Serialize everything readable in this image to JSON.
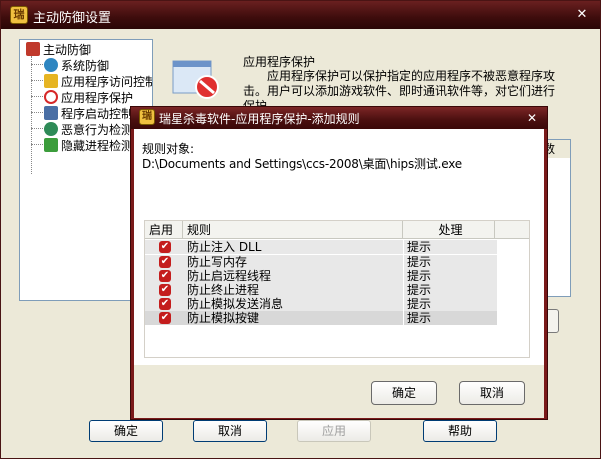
{
  "main_window": {
    "title": "主动防御设置",
    "close_glyph": "✕",
    "icon_glyph": "瑞"
  },
  "tree": {
    "items": [
      {
        "label": "主动防御",
        "icon": "shield-icon",
        "color": "#c0392b"
      },
      {
        "label": "系统防御",
        "icon": "globe-shield-icon",
        "color": "#2e86c1"
      },
      {
        "label": "应用程序访问控制",
        "icon": "folder-key-icon",
        "color": "#e6b422"
      },
      {
        "label": "应用程序保护",
        "icon": "no-entry-icon",
        "color": "#d62828"
      },
      {
        "label": "程序启动控制",
        "icon": "window-icon",
        "color": "#4a6fa5"
      },
      {
        "label": "恶意行为检测",
        "icon": "globe-scan-icon",
        "color": "#2e8b57"
      },
      {
        "label": "隐藏进程检测",
        "icon": "download-scan-icon",
        "color": "#3c9d3c"
      }
    ]
  },
  "pane": {
    "title": "应用程序保护",
    "description": "应用程序保护可以保护指定的应用程序不被恶意程序攻击。用户可以添加游戏软件、即时通讯软件等，对它们进行保护",
    "list_col": "数"
  },
  "main_buttons": {
    "ok": "确定",
    "cancel": "取消",
    "apply": "应用",
    "help": "帮助"
  },
  "dialog": {
    "title": "瑞星杀毒软件-应用程序保护-添加规则",
    "close_glyph": "✕",
    "target_label": "规则对象:",
    "target_path": "D:\\Documents and Settings\\ccs-2008\\桌面\\hips测试.exe",
    "columns": {
      "enable": "启用",
      "rule": "规则",
      "action": "处理"
    },
    "rules": [
      {
        "name": "防止注入 DLL",
        "action": "提示",
        "enabled": true
      },
      {
        "name": "防止写内存",
        "action": "提示",
        "enabled": true
      },
      {
        "name": "防止启远程线程",
        "action": "提示",
        "enabled": true
      },
      {
        "name": "防止终止进程",
        "action": "提示",
        "enabled": true
      },
      {
        "name": "防止模拟发送消息",
        "action": "提示",
        "enabled": true
      },
      {
        "name": "防止模拟按键",
        "action": "提示",
        "enabled": true
      }
    ],
    "ok": "确定",
    "cancel": "取消"
  }
}
